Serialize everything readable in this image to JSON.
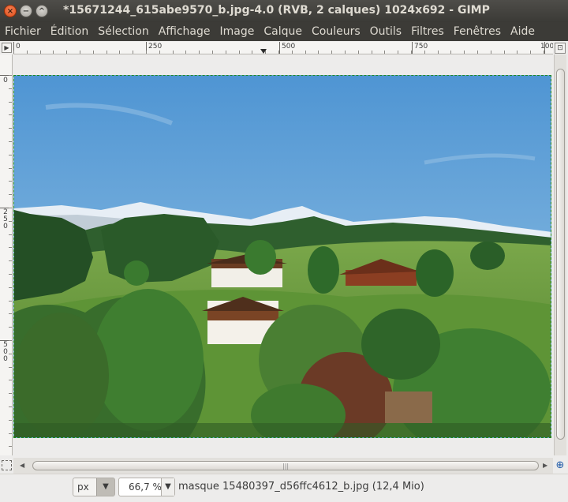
{
  "window": {
    "title": "*15671244_615abe9570_b.jpg-4.0 (RVB, 2 calques) 1024x692 - GIMP",
    "close_glyph": "×",
    "minimize_glyph": "−",
    "maximize_glyph": "^"
  },
  "menubar": {
    "items": [
      "Fichier",
      "Édition",
      "Sélection",
      "Affichage",
      "Image",
      "Calque",
      "Couleurs",
      "Outils",
      "Filtres",
      "Fenêtres",
      "Aide"
    ]
  },
  "ruler": {
    "horizontal_labels": [
      "0",
      "250",
      "500",
      "750",
      "100"
    ],
    "vertical_labels": [
      "0",
      "250",
      "500"
    ]
  },
  "statusbar": {
    "unit": "px",
    "zoom": "66,7 %",
    "message": "masque 15480397_d56ffc4612_b.jpg (12,4 Mio)"
  },
  "icons": {
    "menu_arrow": "▶",
    "navigate": "⊕",
    "dropdown": "▼"
  }
}
